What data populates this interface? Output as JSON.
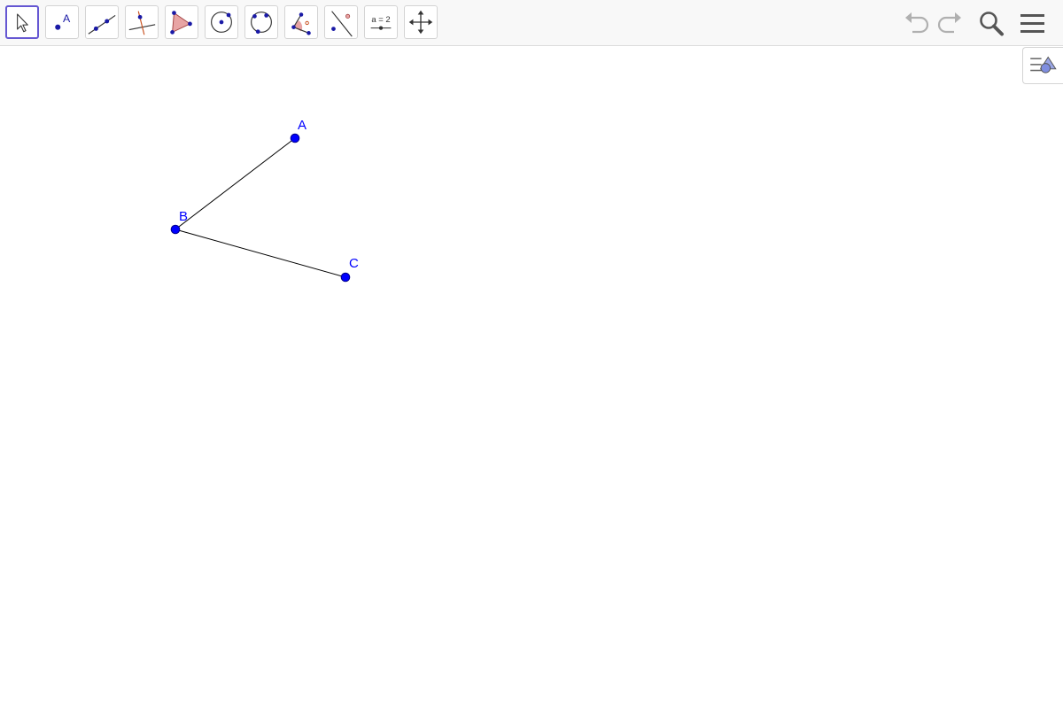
{
  "toolbar": {
    "tools": [
      {
        "id": "move",
        "icon": "move-arrow-icon",
        "selected": true
      },
      {
        "id": "point",
        "icon": "point-icon",
        "label": "A"
      },
      {
        "id": "line",
        "icon": "line-through-two-points-icon"
      },
      {
        "id": "perpendicular",
        "icon": "perpendicular-line-icon"
      },
      {
        "id": "polygon",
        "icon": "polygon-icon"
      },
      {
        "id": "circle",
        "icon": "circle-center-point-icon"
      },
      {
        "id": "circle-three-points",
        "icon": "circle-three-points-icon"
      },
      {
        "id": "angle",
        "icon": "angle-icon"
      },
      {
        "id": "reflect",
        "icon": "reflect-about-line-icon"
      },
      {
        "id": "slider",
        "icon": "slider-icon",
        "label": "a = 2"
      },
      {
        "id": "move-graphics-view",
        "icon": "move-graphics-view-icon"
      }
    ],
    "right": [
      "undo-icon",
      "redo-icon",
      "search-icon",
      "menu-icon"
    ]
  },
  "style_bar_toggle": "style-bar-icon",
  "colors": {
    "point": "#0000ff",
    "point_outline": "#00008b",
    "segment": "#000000",
    "selected_border": "#6557d2",
    "toolbar_bg": "#f8f8f8"
  },
  "geometry": {
    "points": [
      {
        "name": "A",
        "label": "A"
      },
      {
        "name": "B",
        "label": "B"
      },
      {
        "name": "C",
        "label": "C"
      }
    ],
    "segments": [
      {
        "from": "A",
        "to": "B"
      },
      {
        "from": "B",
        "to": "C"
      }
    ]
  }
}
